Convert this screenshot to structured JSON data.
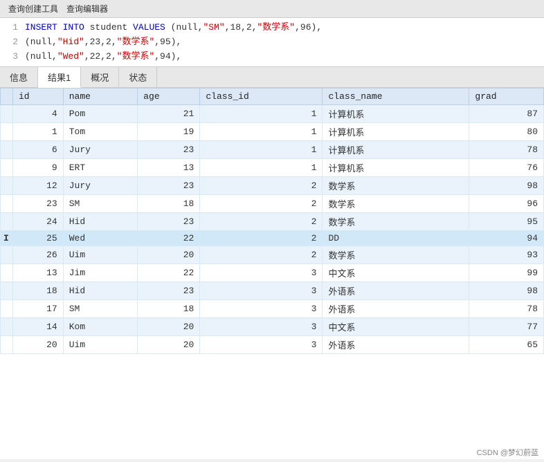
{
  "toolbar": {
    "btn1": "查询创建工具",
    "btn2": "查询编辑器"
  },
  "sql": {
    "lines": [
      {
        "num": "1",
        "parts": [
          {
            "type": "kw",
            "text": "INSERT INTO "
          },
          {
            "type": "plain",
            "text": "student "
          },
          {
            "type": "kw",
            "text": "VALUES "
          },
          {
            "type": "plain",
            "text": "(null,"
          },
          {
            "type": "str",
            "text": "\"SM\""
          },
          {
            "type": "plain",
            "text": ",18,2,"
          },
          {
            "type": "str",
            "text": "\"数学系\""
          },
          {
            "type": "plain",
            "text": ",96),"
          }
        ]
      },
      {
        "num": "2",
        "parts": [
          {
            "type": "plain",
            "text": "(null,"
          },
          {
            "type": "str",
            "text": "\"Hid\""
          },
          {
            "type": "plain",
            "text": ",23,2,"
          },
          {
            "type": "str",
            "text": "\"数学系\""
          },
          {
            "type": "plain",
            "text": ",95),"
          }
        ]
      },
      {
        "num": "3",
        "parts": [
          {
            "type": "plain",
            "text": "(null,"
          },
          {
            "type": "str",
            "text": "\"Wed\""
          },
          {
            "type": "plain",
            "text": ",22,2,"
          },
          {
            "type": "str",
            "text": "\"数学系\""
          },
          {
            "type": "plain",
            "text": ",94),"
          }
        ]
      }
    ]
  },
  "tabs": [
    "信息",
    "结果1",
    "概况",
    "状态"
  ],
  "active_tab": "结果1",
  "table": {
    "headers": [
      "id",
      "name",
      "age",
      "class_id",
      "class_name",
      "grad"
    ],
    "rows": [
      {
        "indicator": "",
        "id": "4",
        "name": "Pom",
        "age": "21",
        "class_id": "1",
        "class_name": "计算机系",
        "grad": "87",
        "selected": false
      },
      {
        "indicator": "",
        "id": "1",
        "name": "Tom",
        "age": "19",
        "class_id": "1",
        "class_name": "计算机系",
        "grad": "80",
        "selected": false
      },
      {
        "indicator": "",
        "id": "6",
        "name": "Jury",
        "age": "23",
        "class_id": "1",
        "class_name": "计算机系",
        "grad": "78",
        "selected": false
      },
      {
        "indicator": "",
        "id": "9",
        "name": "ERT",
        "age": "13",
        "class_id": "1",
        "class_name": "计算机系",
        "grad": "76",
        "selected": false
      },
      {
        "indicator": "",
        "id": "12",
        "name": "Jury",
        "age": "23",
        "class_id": "2",
        "class_name": "数学系",
        "grad": "98",
        "selected": false
      },
      {
        "indicator": "",
        "id": "23",
        "name": "SM",
        "age": "18",
        "class_id": "2",
        "class_name": "数学系",
        "grad": "96",
        "selected": false
      },
      {
        "indicator": "",
        "id": "24",
        "name": "Hid",
        "age": "23",
        "class_id": "2",
        "class_name": "数学系",
        "grad": "95",
        "selected": false
      },
      {
        "indicator": "I",
        "id": "25",
        "name": "Wed",
        "age": "22",
        "class_id": "2",
        "class_name": "DD",
        "grad": "94",
        "selected": true
      },
      {
        "indicator": "",
        "id": "26",
        "name": "Uim",
        "age": "20",
        "class_id": "2",
        "class_name": "数学系",
        "grad": "93",
        "selected": false
      },
      {
        "indicator": "",
        "id": "13",
        "name": "Jim",
        "age": "22",
        "class_id": "3",
        "class_name": "中文系",
        "grad": "99",
        "selected": false
      },
      {
        "indicator": "",
        "id": "18",
        "name": "Hid",
        "age": "23",
        "class_id": "3",
        "class_name": "外语系",
        "grad": "98",
        "selected": false
      },
      {
        "indicator": "",
        "id": "17",
        "name": "SM",
        "age": "18",
        "class_id": "3",
        "class_name": "外语系",
        "grad": "78",
        "selected": false
      },
      {
        "indicator": "",
        "id": "14",
        "name": "Kom",
        "age": "20",
        "class_id": "3",
        "class_name": "中文系",
        "grad": "77",
        "selected": false
      },
      {
        "indicator": "",
        "id": "20",
        "name": "Uim",
        "age": "20",
        "class_id": "3",
        "class_name": "外语系",
        "grad": "65",
        "selected": false
      }
    ]
  },
  "watermark": "CSDN @梦幻蔚蓝"
}
